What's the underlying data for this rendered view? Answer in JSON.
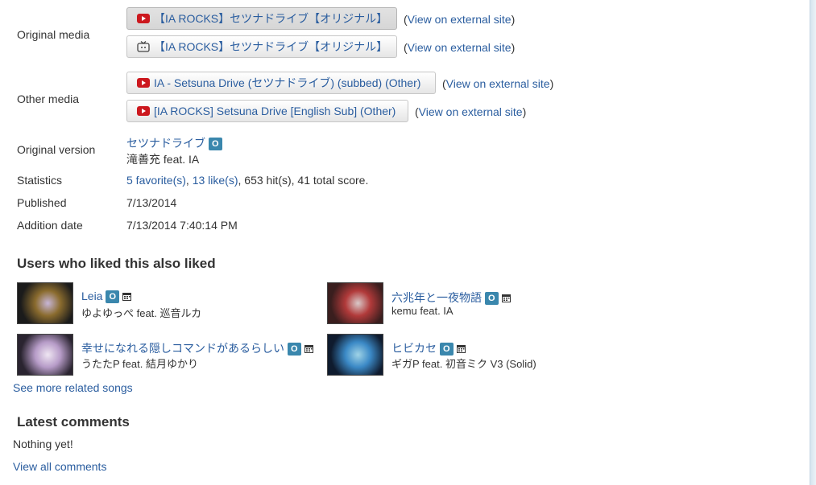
{
  "labels": {
    "original_media": "Original media",
    "other_media": "Other media",
    "original_version": "Original version",
    "statistics": "Statistics",
    "published": "Published",
    "addition_date": "Addition date"
  },
  "original_media": [
    {
      "icon": "youtube-icon",
      "title": "【IA ROCKS】セツナドライブ【オリジナル】",
      "ext_open": "(",
      "ext_link": "View on external site",
      "ext_close": ")"
    },
    {
      "icon": "niconico-icon",
      "title": "【IA ROCKS】セツナドライブ【オリジナル】",
      "ext_open": "(",
      "ext_link": "View on external site",
      "ext_close": ")"
    }
  ],
  "other_media": [
    {
      "icon": "youtube-icon",
      "title": "IA - Setsuna Drive (セツナドライブ) (subbed) (Other)",
      "ext_open": "(",
      "ext_link": "View on external site",
      "ext_close": ")"
    },
    {
      "icon": "youtube-icon",
      "title": "[IA ROCKS] Setsuna Drive [English Sub] (Other)",
      "ext_open": "(",
      "ext_link": "View on external site",
      "ext_close": ")"
    }
  ],
  "original_version": {
    "title": "セツナドライブ",
    "badge": "O",
    "artist": "滝善充 feat. IA"
  },
  "statistics": {
    "favorites": "5 favorite(s)",
    "sep1": ", ",
    "likes": "13 like(s)",
    "rest": ", 653 hit(s), 41 total score."
  },
  "published": "7/13/2014",
  "addition_date": "7/13/2014 7:40:14 PM",
  "related": {
    "heading": "Users who liked this also liked",
    "songs": [
      {
        "title": "Leia",
        "badge": "O",
        "artist": "ゆよゆっぺ feat. 巡音ルカ",
        "thumb_colors": [
          "#1b1b1b",
          "#8a6b2e",
          "#c7b6d8"
        ]
      },
      {
        "title": "六兆年と一夜物語",
        "badge": "O",
        "artist": "kemu feat. IA",
        "thumb_colors": [
          "#3a1e1e",
          "#b13a3a",
          "#d9c9c9"
        ]
      },
      {
        "title": "幸せになれる隠しコマンドがあるらしい",
        "badge": "O",
        "artist": "うたたP feat. 結月ゆかり",
        "thumb_colors": [
          "#2a2430",
          "#b79cc8",
          "#efe6f2"
        ]
      },
      {
        "title": "ヒビカセ",
        "badge": "O",
        "artist": "ギガP feat. 初音ミク V3 (Solid)",
        "thumb_colors": [
          "#0f1b2e",
          "#3b89c6",
          "#9fd3e6"
        ]
      }
    ],
    "see_more": "See more related songs"
  },
  "comments": {
    "heading": "Latest comments",
    "empty": "Nothing yet!",
    "view_all": "View all comments"
  }
}
